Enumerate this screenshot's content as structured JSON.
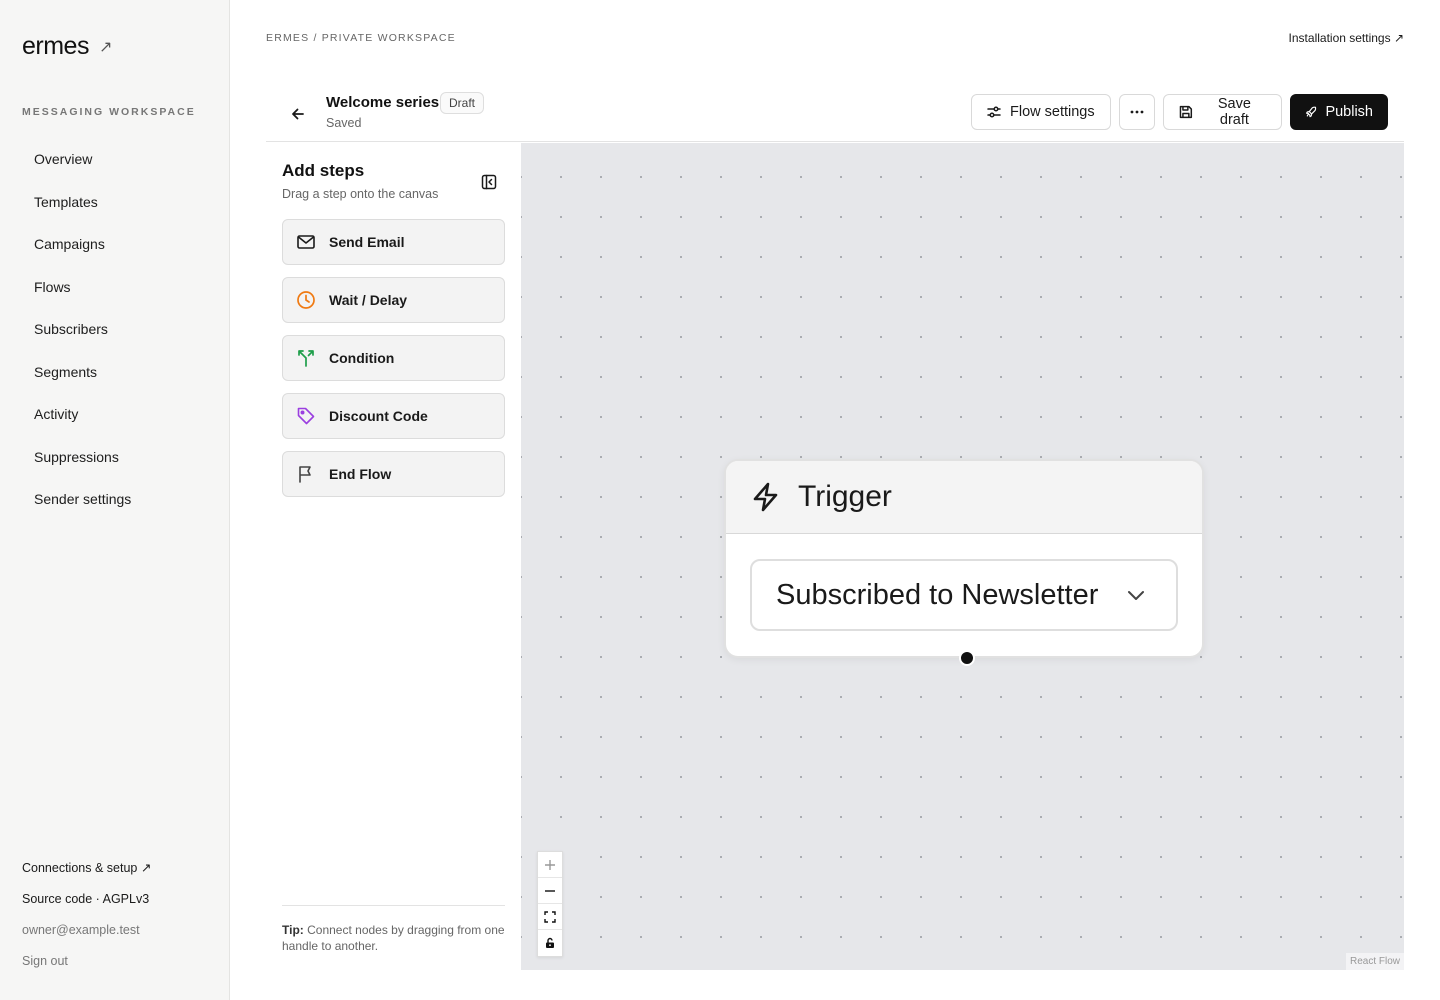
{
  "sidebar": {
    "brand": "ermes",
    "brand_arrow": "↗",
    "section_label": "MESSAGING WORKSPACE",
    "items": [
      {
        "label": "Overview"
      },
      {
        "label": "Templates"
      },
      {
        "label": "Campaigns"
      },
      {
        "label": "Flows"
      },
      {
        "label": "Subscribers"
      },
      {
        "label": "Segments"
      },
      {
        "label": "Activity"
      },
      {
        "label": "Suppressions"
      },
      {
        "label": "Sender settings"
      }
    ],
    "footer": {
      "connections": "Connections & setup ↗",
      "source": "Source code · AGPLv3",
      "email": "owner@example.test",
      "signout": "Sign out"
    }
  },
  "topbar": {
    "breadcrumb": "ERMES / PRIVATE WORKSPACE",
    "install_link": "Installation settings ↗"
  },
  "header": {
    "title": "Welcome series",
    "badge": "Draft",
    "status": "Saved",
    "flow_settings": "Flow settings",
    "save_draft": "Save draft",
    "publish": "Publish"
  },
  "steps_panel": {
    "title": "Add steps",
    "subtitle": "Drag a step onto the canvas",
    "items": [
      {
        "label": "Send Email",
        "icon": "mail-icon",
        "color": "#1a1a1a"
      },
      {
        "label": "Wait / Delay",
        "icon": "clock-icon",
        "color": "#f07a12"
      },
      {
        "label": "Condition",
        "icon": "split-icon",
        "color": "#1e9e4a"
      },
      {
        "label": "Discount Code",
        "icon": "tag-icon",
        "color": "#9b3fe0"
      },
      {
        "label": "End Flow",
        "icon": "flag-icon",
        "color": "#444444"
      }
    ],
    "tip_label": "Tip:",
    "tip_text": " Connect nodes by dragging from one handle to another."
  },
  "canvas": {
    "node": {
      "title": "Trigger",
      "select_value": "Subscribed to Newsletter"
    },
    "attribution": "React Flow"
  }
}
